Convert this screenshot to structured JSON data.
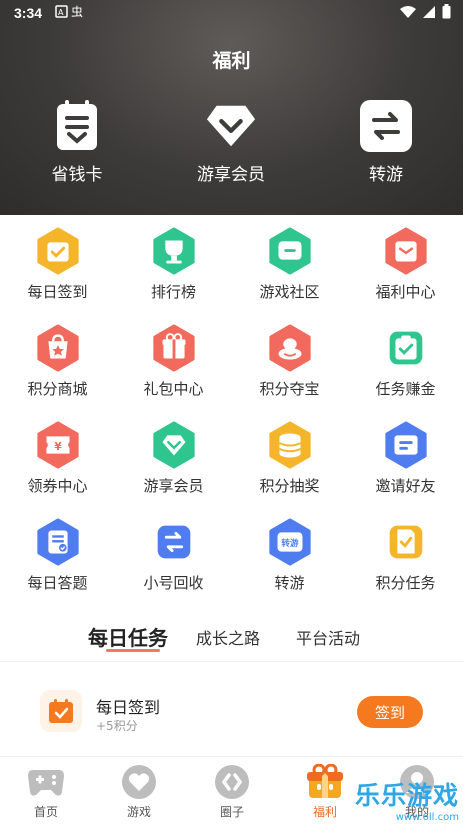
{
  "status_bar": {
    "time": "3:34"
  },
  "header": {
    "title": "福利",
    "items": [
      {
        "label": "省钱卡",
        "icon": "card-icon"
      },
      {
        "label": "游享会员",
        "icon": "diamond-icon"
      },
      {
        "label": "转游",
        "icon": "transfer-icon"
      }
    ]
  },
  "grid": [
    {
      "label": "每日签到",
      "icon": "calendar-check-icon",
      "color": "#f5b52a"
    },
    {
      "label": "排行榜",
      "icon": "trophy-icon",
      "color": "#2ec58f"
    },
    {
      "label": "游戏社区",
      "icon": "chat-icon",
      "color": "#2ec58f"
    },
    {
      "label": "福利中心",
      "icon": "gift-box-icon",
      "color": "#f26a5d"
    },
    {
      "label": "积分商城",
      "icon": "shop-bag-icon",
      "color": "#f26a5d"
    },
    {
      "label": "礼包中心",
      "icon": "gift-icon",
      "color": "#f26a5d"
    },
    {
      "label": "积分夺宝",
      "icon": "treasure-icon",
      "color": "#f26a5d"
    },
    {
      "label": "任务赚金",
      "icon": "clipboard-check-icon",
      "color": "#2ec58f"
    },
    {
      "label": "领券中心",
      "icon": "coupon-icon",
      "color": "#f26a5d"
    },
    {
      "label": "游享会员",
      "icon": "diamond-icon",
      "color": "#2ec58f"
    },
    {
      "label": "积分抽奖",
      "icon": "coins-icon",
      "color": "#f5b52a"
    },
    {
      "label": "邀请好友",
      "icon": "invite-icon",
      "color": "#4f7df0"
    },
    {
      "label": "每日答题",
      "icon": "quiz-icon",
      "color": "#4f7df0"
    },
    {
      "label": "小号回收",
      "icon": "recycle-icon",
      "color": "#4f7df0"
    },
    {
      "label": "转游",
      "icon": "transfer-tag-icon",
      "color": "#4f7df0",
      "badge": "转游"
    },
    {
      "label": "积分任务",
      "icon": "task-note-icon",
      "color": "#f5b52a"
    }
  ],
  "tabs": [
    {
      "label": "每日任务",
      "active": true
    },
    {
      "label": "成长之路",
      "active": false
    },
    {
      "label": "平台活动",
      "active": false
    }
  ],
  "task": {
    "name": "每日签到",
    "points": "+5积分",
    "button": "签到"
  },
  "nav": [
    {
      "label": "首页",
      "icon": "gamepad-icon"
    },
    {
      "label": "游戏",
      "icon": "heart-icon"
    },
    {
      "label": "圈子",
      "icon": "circle-icon"
    },
    {
      "label": "福利",
      "icon": "gift-icon",
      "active": true
    },
    {
      "label": "我的",
      "icon": "user-icon"
    }
  ],
  "watermark": {
    "text": "乐乐游戏",
    "url": "www.6ll.com"
  }
}
